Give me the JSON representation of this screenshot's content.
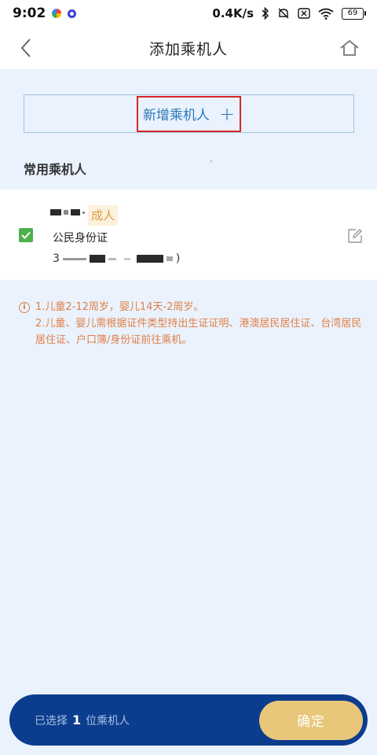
{
  "status_bar": {
    "time": "9:02",
    "speed": "0.4K/s",
    "battery": "69"
  },
  "header": {
    "title": "添加乘机人",
    "back_icon": "chevron-left-icon",
    "home_icon": "home-icon"
  },
  "add_passenger": {
    "label": "新增乘机人",
    "icon": "plus-icon",
    "plus_glyph": "+"
  },
  "frequent_section": {
    "title": "常用乘机人"
  },
  "passenger": {
    "checked": true,
    "type_badge": "成人",
    "id_type": "公民身份证",
    "id_prefix": "3",
    "id_suffix": ")"
  },
  "notes": {
    "line1": "1.儿童2-12周岁，婴儿14天-2周岁。",
    "line2": "2.儿童、婴儿需根据证件类型持出生证证明、港澳居民居住证、台湾居民居住证、户口簿/身份证前往乘机。"
  },
  "bottom_bar": {
    "selected_prefix": "已选择",
    "selected_count": "1",
    "selected_suffix": "位乘机人",
    "confirm_label": "确定"
  },
  "colors": {
    "accent_blue": "#0c3c8d",
    "confirm_gold": "#e8c77a",
    "note_orange": "#e17f45",
    "check_green": "#4cb04c",
    "highlight_red": "#d9262a"
  }
}
